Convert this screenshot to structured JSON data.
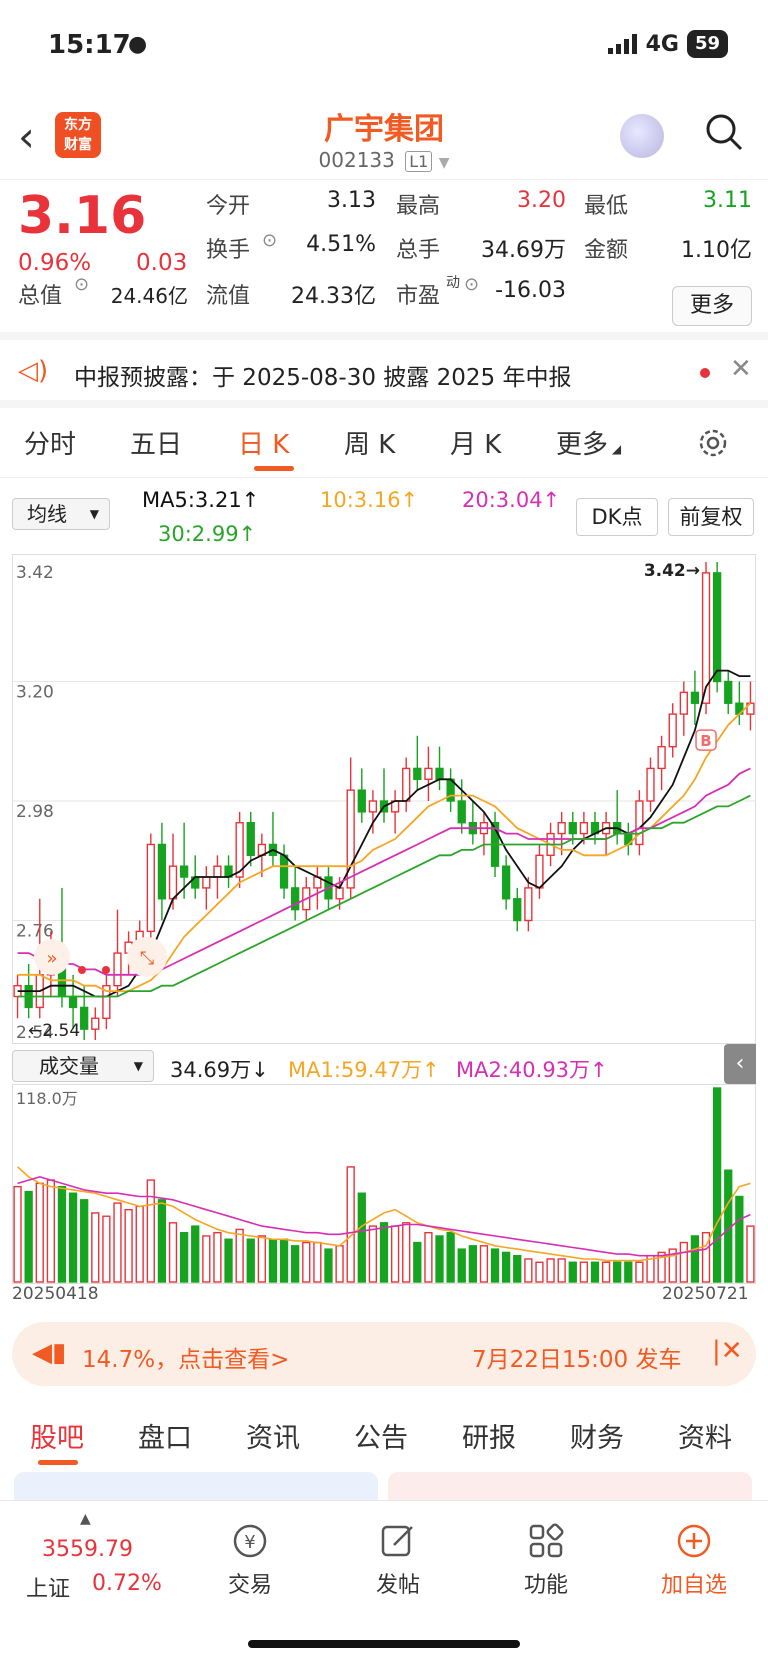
{
  "status": {
    "time": "15:17",
    "network": "4G",
    "battery": "59"
  },
  "header": {
    "logo_text_1": "东方",
    "logo_text_2": "财富",
    "stock_name": "广宇集团",
    "stock_code": "002133",
    "level": "L1"
  },
  "quote": {
    "price": "3.16",
    "change_pct": "0.96%",
    "change": "0.03",
    "open_label": "今开",
    "open": "3.13",
    "high_label": "最高",
    "high": "3.20",
    "low_label": "最低",
    "low": "3.11",
    "turnover_label": "换手",
    "turnover": "4.51%",
    "volume_label": "总手",
    "volume": "34.69万",
    "amount_label": "金额",
    "amount": "1.10亿",
    "mktcap_label": "总值",
    "mktcap": "24.46亿",
    "float_label": "流值",
    "float": "24.33亿",
    "pe_label": "市盈",
    "pe_sup": "动",
    "pe": "-16.03",
    "more_label": "更多"
  },
  "notice": {
    "text": "中报预披露：于 2025-08-30 披露 2025 年中报"
  },
  "tabs": [
    "分时",
    "五日",
    "日 K",
    "周 K",
    "月 K",
    "更多"
  ],
  "ma_bar": {
    "select": "均线",
    "ma5": "MA5:3.21↑",
    "ma10": "10:3.16↑",
    "ma20": "20:3.04↑",
    "ma30": "30:2.99↑",
    "dk": "DK点",
    "fq": "前复权"
  },
  "vol_bar": {
    "select": "成交量",
    "value": "34.69万↓",
    "ma1": "MA1:59.47万↑",
    "ma2": "MA2:40.93万↑"
  },
  "colors": {
    "up": "#e8333a",
    "down": "#16a31f",
    "ma5": "#111111",
    "ma10": "#f5a623",
    "ma20": "#d62fb5",
    "ma30": "#2aa52a",
    "accent": "#f15a22"
  },
  "chart_data": {
    "type": "candlestick",
    "ylabels": [
      "3.42",
      "3.20",
      "2.98",
      "2.76",
      "2.54"
    ],
    "ylim": [
      2.54,
      3.42
    ],
    "max_label": "3.42→",
    "min_label": "←2.54",
    "marker": "B",
    "ohlc": [
      [
        2.62,
        2.66,
        2.58,
        2.64
      ],
      [
        2.64,
        2.68,
        2.58,
        2.6
      ],
      [
        2.6,
        2.8,
        2.58,
        2.66
      ],
      [
        2.66,
        2.74,
        2.62,
        2.7
      ],
      [
        2.7,
        2.82,
        2.6,
        2.62
      ],
      [
        2.62,
        2.66,
        2.56,
        2.6
      ],
      [
        2.6,
        2.64,
        2.54,
        2.56
      ],
      [
        2.56,
        2.6,
        2.54,
        2.58
      ],
      [
        2.58,
        2.66,
        2.56,
        2.64
      ],
      [
        2.64,
        2.78,
        2.62,
        2.7
      ],
      [
        2.7,
        2.74,
        2.66,
        2.72
      ],
      [
        2.72,
        2.76,
        2.68,
        2.74
      ],
      [
        2.74,
        2.92,
        2.72,
        2.9
      ],
      [
        2.9,
        2.94,
        2.76,
        2.8
      ],
      [
        2.8,
        2.92,
        2.78,
        2.86
      ],
      [
        2.86,
        2.94,
        2.8,
        2.84
      ],
      [
        2.84,
        2.88,
        2.8,
        2.82
      ],
      [
        2.82,
        2.86,
        2.78,
        2.84
      ],
      [
        2.84,
        2.88,
        2.8,
        2.86
      ],
      [
        2.86,
        2.88,
        2.82,
        2.84
      ],
      [
        2.84,
        2.96,
        2.82,
        2.94
      ],
      [
        2.94,
        2.96,
        2.86,
        2.88
      ],
      [
        2.88,
        2.92,
        2.84,
        2.9
      ],
      [
        2.9,
        2.96,
        2.86,
        2.88
      ],
      [
        2.88,
        2.9,
        2.8,
        2.82
      ],
      [
        2.82,
        2.86,
        2.76,
        2.78
      ],
      [
        2.78,
        2.84,
        2.76,
        2.82
      ],
      [
        2.82,
        2.86,
        2.78,
        2.84
      ],
      [
        2.84,
        2.86,
        2.78,
        2.8
      ],
      [
        2.8,
        2.84,
        2.78,
        2.82
      ],
      [
        2.82,
        3.06,
        2.8,
        3.0
      ],
      [
        3.0,
        3.04,
        2.94,
        2.96
      ],
      [
        2.96,
        3.0,
        2.92,
        2.98
      ],
      [
        2.98,
        3.04,
        2.94,
        2.96
      ],
      [
        2.96,
        3.0,
        2.92,
        2.98
      ],
      [
        2.98,
        3.06,
        2.96,
        3.04
      ],
      [
        3.04,
        3.1,
        3.0,
        3.02
      ],
      [
        3.02,
        3.08,
        2.98,
        3.04
      ],
      [
        3.04,
        3.08,
        3.0,
        3.02
      ],
      [
        3.02,
        3.04,
        2.96,
        2.98
      ],
      [
        2.98,
        3.02,
        2.92,
        2.94
      ],
      [
        2.94,
        2.98,
        2.9,
        2.92
      ],
      [
        2.92,
        2.96,
        2.88,
        2.94
      ],
      [
        2.94,
        2.96,
        2.84,
        2.86
      ],
      [
        2.86,
        2.88,
        2.78,
        2.8
      ],
      [
        2.8,
        2.82,
        2.74,
        2.76
      ],
      [
        2.76,
        2.84,
        2.74,
        2.82
      ],
      [
        2.82,
        2.9,
        2.8,
        2.88
      ],
      [
        2.88,
        2.94,
        2.86,
        2.92
      ],
      [
        2.92,
        2.96,
        2.88,
        2.94
      ],
      [
        2.94,
        2.96,
        2.9,
        2.92
      ],
      [
        2.92,
        2.96,
        2.9,
        2.94
      ],
      [
        2.94,
        2.96,
        2.9,
        2.92
      ],
      [
        2.92,
        2.96,
        2.88,
        2.94
      ],
      [
        2.94,
        3.0,
        2.9,
        2.92
      ],
      [
        2.92,
        2.94,
        2.88,
        2.9
      ],
      [
        2.9,
        3.0,
        2.88,
        2.98
      ],
      [
        2.98,
        3.06,
        2.96,
        3.04
      ],
      [
        3.04,
        3.1,
        3.0,
        3.08
      ],
      [
        3.08,
        3.16,
        3.06,
        3.14
      ],
      [
        3.14,
        3.2,
        3.1,
        3.18
      ],
      [
        3.18,
        3.22,
        3.12,
        3.16
      ],
      [
        3.16,
        3.42,
        3.14,
        3.4
      ],
      [
        3.4,
        3.42,
        3.18,
        3.2
      ],
      [
        3.2,
        3.22,
        3.14,
        3.16
      ],
      [
        3.16,
        3.2,
        3.12,
        3.14
      ],
      [
        3.14,
        3.2,
        3.11,
        3.16
      ]
    ],
    "ma5": [
      2.63,
      2.63,
      2.63,
      2.64,
      2.64,
      2.64,
      2.63,
      2.62,
      2.62,
      2.63,
      2.64,
      2.67,
      2.7,
      2.75,
      2.8,
      2.82,
      2.84,
      2.84,
      2.84,
      2.84,
      2.85,
      2.87,
      2.88,
      2.89,
      2.88,
      2.86,
      2.85,
      2.84,
      2.83,
      2.82,
      2.86,
      2.9,
      2.94,
      2.97,
      2.98,
      2.98,
      3.0,
      3.01,
      3.02,
      3.02,
      3.0,
      2.98,
      2.96,
      2.93,
      2.89,
      2.86,
      2.83,
      2.82,
      2.84,
      2.86,
      2.89,
      2.91,
      2.92,
      2.93,
      2.93,
      2.92,
      2.93,
      2.95,
      2.98,
      3.01,
      3.06,
      3.11,
      3.19,
      3.22,
      3.22,
      3.21,
      3.21
    ],
    "ma10": [
      2.66,
      2.66,
      2.66,
      2.65,
      2.65,
      2.65,
      2.64,
      2.64,
      2.63,
      2.63,
      2.63,
      2.64,
      2.65,
      2.67,
      2.7,
      2.73,
      2.75,
      2.77,
      2.79,
      2.81,
      2.83,
      2.84,
      2.85,
      2.86,
      2.86,
      2.86,
      2.86,
      2.86,
      2.86,
      2.86,
      2.86,
      2.87,
      2.89,
      2.9,
      2.91,
      2.93,
      2.95,
      2.97,
      2.98,
      2.99,
      2.99,
      2.99,
      2.98,
      2.97,
      2.95,
      2.93,
      2.92,
      2.91,
      2.9,
      2.89,
      2.89,
      2.88,
      2.88,
      2.88,
      2.89,
      2.9,
      2.92,
      2.93,
      2.95,
      2.97,
      2.99,
      3.02,
      3.06,
      3.09,
      3.12,
      3.14,
      3.16
    ],
    "ma20": [
      2.7,
      2.7,
      2.69,
      2.69,
      2.68,
      2.68,
      2.67,
      2.67,
      2.66,
      2.66,
      2.66,
      2.66,
      2.67,
      2.67,
      2.68,
      2.69,
      2.7,
      2.71,
      2.72,
      2.73,
      2.74,
      2.75,
      2.76,
      2.77,
      2.78,
      2.79,
      2.8,
      2.81,
      2.82,
      2.83,
      2.84,
      2.85,
      2.86,
      2.87,
      2.88,
      2.89,
      2.9,
      2.91,
      2.92,
      2.93,
      2.93,
      2.93,
      2.93,
      2.93,
      2.92,
      2.92,
      2.91,
      2.91,
      2.91,
      2.91,
      2.91,
      2.91,
      2.91,
      2.91,
      2.92,
      2.92,
      2.93,
      2.93,
      2.94,
      2.95,
      2.96,
      2.97,
      2.99,
      3.0,
      3.01,
      3.03,
      3.04
    ],
    "ma30": [
      2.62,
      2.62,
      2.62,
      2.62,
      2.62,
      2.62,
      2.62,
      2.62,
      2.62,
      2.62,
      2.63,
      2.63,
      2.63,
      2.64,
      2.64,
      2.65,
      2.66,
      2.67,
      2.68,
      2.69,
      2.7,
      2.71,
      2.72,
      2.73,
      2.74,
      2.75,
      2.76,
      2.77,
      2.78,
      2.79,
      2.8,
      2.81,
      2.82,
      2.83,
      2.84,
      2.85,
      2.86,
      2.87,
      2.88,
      2.88,
      2.89,
      2.89,
      2.9,
      2.9,
      2.9,
      2.9,
      2.9,
      2.9,
      2.9,
      2.9,
      2.91,
      2.91,
      2.91,
      2.91,
      2.92,
      2.92,
      2.92,
      2.93,
      2.93,
      2.94,
      2.94,
      2.95,
      2.96,
      2.97,
      2.97,
      2.98,
      2.99
    ],
    "volume": {
      "ylabel": "118.0万",
      "ymax": 118,
      "values": [
        58,
        55,
        60,
        62,
        58,
        54,
        50,
        42,
        40,
        48,
        44,
        46,
        62,
        50,
        36,
        30,
        34,
        28,
        30,
        26,
        32,
        26,
        28,
        26,
        26,
        22,
        24,
        24,
        20,
        22,
        70,
        54,
        34,
        36,
        34,
        36,
        24,
        30,
        28,
        30,
        20,
        22,
        22,
        20,
        18,
        16,
        14,
        12,
        14,
        14,
        12,
        12,
        12,
        12,
        12,
        12,
        12,
        16,
        18,
        20,
        24,
        28,
        30,
        118,
        68,
        52,
        34
      ],
      "ma1": [
        70,
        64,
        60,
        58,
        57,
        56,
        55,
        54,
        52,
        50,
        48,
        46,
        47,
        48,
        46,
        42,
        38,
        35,
        32,
        30,
        29,
        28,
        27,
        26,
        26,
        25,
        25,
        24,
        23,
        22,
        28,
        34,
        38,
        42,
        44,
        40,
        36,
        34,
        32,
        31,
        28,
        26,
        24,
        22,
        21,
        20,
        19,
        18,
        17,
        16,
        15,
        14,
        14,
        13,
        13,
        13,
        13,
        14,
        15,
        16,
        18,
        20,
        22,
        36,
        48,
        58,
        60
      ],
      "ma2": [
        60,
        62,
        64,
        62,
        60,
        58,
        56,
        55,
        54,
        54,
        53,
        52,
        52,
        51,
        50,
        48,
        46,
        44,
        42,
        40,
        38,
        36,
        34,
        33,
        32,
        31,
        30,
        30,
        29,
        29,
        30,
        31,
        32,
        33,
        34,
        35,
        35,
        34,
        33,
        32,
        31,
        30,
        29,
        28,
        27,
        26,
        25,
        24,
        23,
        22,
        21,
        20,
        19,
        18,
        17,
        17,
        16,
        16,
        16,
        17,
        18,
        19,
        20,
        26,
        32,
        38,
        41
      ]
    },
    "x_start": "20250418",
    "x_end": "20250721"
  },
  "promo": {
    "left": "14.7%，点击查看>",
    "right": "7月22日15:00 发车"
  },
  "bottom_tabs": [
    "股吧",
    "盘口",
    "资讯",
    "公告",
    "研报",
    "财务",
    "资料"
  ],
  "nav": {
    "index_value": "3559.79",
    "index_name": "上证",
    "index_pct": "0.72%",
    "trade": "交易",
    "post": "发帖",
    "function": "功能",
    "watch": "加自选"
  }
}
